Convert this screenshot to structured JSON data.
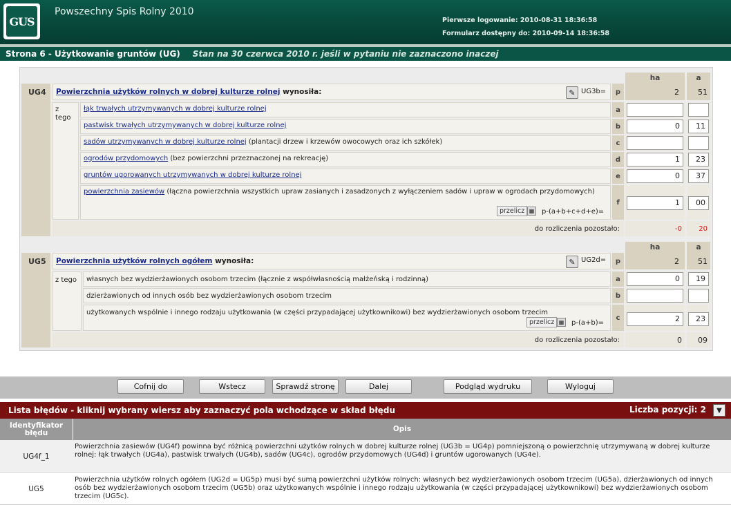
{
  "header": {
    "logo_text": "GUS",
    "app_title": "Powszechny Spis Rolny 2010",
    "first_login": "Pierwsze logowanie: 2010-08-31 18:36:58",
    "form_available": "Formularz dostępny do: 2010-09-14 18:36:58"
  },
  "page": {
    "title": "Strona 6 - Użytkowanie gruntów (UG)",
    "subtitle": "Stan na 30 czerwca 2010 r. jeśli w pytaniu nie zaznaczono inaczej"
  },
  "columns": {
    "ha": "ha",
    "a": "a"
  },
  "ug4": {
    "label": "UG4",
    "question_link": "Powierzchnia użytków rolnych w dobrej kulturze rolnej",
    "question_rest": " wynosiła:",
    "ref": "UG3b=",
    "p_letter": "p",
    "p_ha": "2",
    "p_a": "51",
    "z_tego": "z tego",
    "rows": [
      {
        "letter": "a",
        "link": "łąk trwałych utrzymywanych w dobrej kulturze rolnej",
        "rest": "",
        "ha": "",
        "a": ""
      },
      {
        "letter": "b",
        "link": "pastwisk trwałych utrzymywanych w dobrej kulturze rolnej",
        "rest": "",
        "ha": "0",
        "a": "11"
      },
      {
        "letter": "c",
        "link": "sadów utrzymywanych w dobrej kulturze rolnej",
        "rest": " (plantacji drzew i krzewów owocowych oraz ich szkółek)",
        "ha": "",
        "a": ""
      },
      {
        "letter": "d",
        "link": "ogrodów przydomowych",
        "rest": " (bez powierzchni przeznaczonej na rekreację)",
        "ha": "1",
        "a": "23"
      },
      {
        "letter": "e",
        "link": "gruntów ugorowanych utrzymywanych w dobrej kulturze rolnej",
        "rest": "",
        "ha": "0",
        "a": "37"
      }
    ],
    "f_letter": "f",
    "f_link": "powierzchnia zasiewów",
    "f_rest": " (łączna powierzchnia wszystkich upraw zasianych i zasadzonych z wyłączeniem sadów i upraw w ogrodach przydomowych)",
    "f_ha": "1",
    "f_a": "00",
    "przelicz": "przelicz",
    "formula": "p-(a+b+c+d+e)=",
    "remaining_label": "do rozliczenia pozostało:",
    "remaining_ha": "-0",
    "remaining_a": "20"
  },
  "ug5": {
    "label": "UG5",
    "question_link": "Powierzchnia użytków rolnych ogółem",
    "question_rest": " wynosiła:",
    "ref": "UG2d=",
    "p_letter": "p",
    "p_ha": "2",
    "p_a": "51",
    "z_tego": "z tego",
    "rows": [
      {
        "letter": "a",
        "text": "własnych bez wydzierżawionych osobom trzecim (łącznie z współwłasnością małżeńską i rodzinną)",
        "ha": "0",
        "a": "19"
      },
      {
        "letter": "b",
        "text": "dzierżawionych od innych osób bez wydzierżawionych osobom trzecim",
        "ha": "",
        "a": ""
      }
    ],
    "c_letter": "c",
    "c_text": "użytkowanych wspólnie i innego rodzaju użytkowania (w części przypadającej użytkownikowi) bez wydzierżawionych osobom trzecim",
    "c_ha": "2",
    "c_a": "23",
    "przelicz": "przelicz",
    "formula": "p-(a+b)=",
    "remaining_label": "do rozliczenia pozostało:",
    "remaining_ha": "0",
    "remaining_a": "09"
  },
  "nav": {
    "back_to": "Cofnij do",
    "prev": "Wstecz",
    "check": "Sprawdź stronę",
    "next": "Dalej",
    "preview": "Podgląd wydruku",
    "logout": "Wyloguj"
  },
  "errors": {
    "title": "Lista błędów - kliknij wybrany wiersz aby zaznaczyć pola wchodzące w skład błędu",
    "count": "Liczba pozycji: 2",
    "col_id": "Identyfikator błędu",
    "col_desc": "Opis",
    "items": [
      {
        "id": "UG4f_1",
        "desc": "Powierzchnia zasiewów (UG4f) powinna być różnicą powierzchni użytków rolnych w dobrej kulturze rolnej (UG3b = UG4p) pomniejszoną o powierzchnię utrzymywaną w dobrej kulturze rolnej: łąk trwałych (UG4a), pastwisk trwałych (UG4b), sadów (UG4c), ogrodów przydomowych (UG4d) i gruntów ugorowanych (UG4e)."
      },
      {
        "id": "UG5",
        "desc": "Powierzchnia użytków rolnych ogółem (UG2d = UG5p) musi być sumą powierzchni użytków rolnych: własnych bez wydzierżawionych osobom trzecim (UG5a), dzierżawionych od innych osób bez wydzierżawionych osobom trzecim (UG5b) oraz użytkowanych wspólnie i innego rodzaju użytkowania (w części przypadającej użytkownikowi) bez wydzierżawionych osobom trzecim (UG5c)."
      }
    ]
  }
}
